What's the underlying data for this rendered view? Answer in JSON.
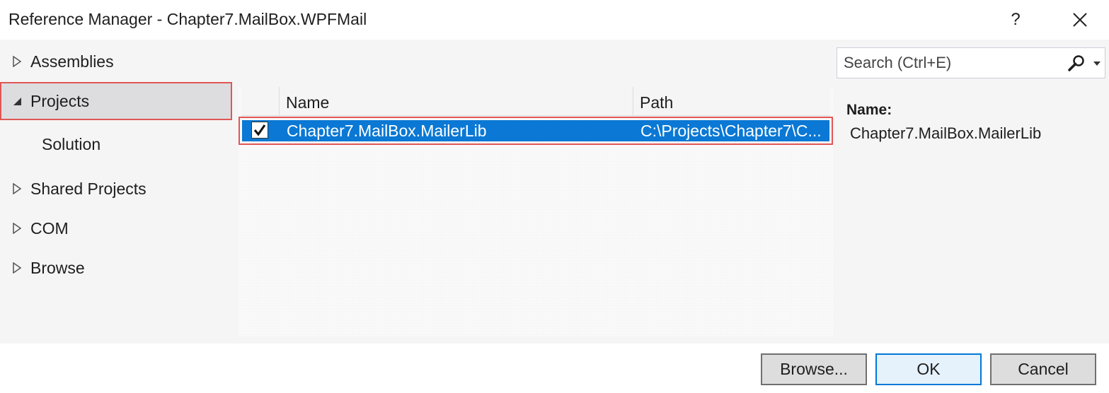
{
  "window": {
    "title": "Reference Manager - Chapter7.MailBox.WPFMail",
    "help_label": "?"
  },
  "nav": {
    "items": [
      {
        "label": "Assemblies",
        "expanded": false
      },
      {
        "label": "Projects",
        "expanded": true,
        "selected": true
      },
      {
        "label": "Solution",
        "child": true
      },
      {
        "label": "Shared Projects",
        "expanded": false
      },
      {
        "label": "COM",
        "expanded": false
      },
      {
        "label": "Browse",
        "expanded": false
      }
    ]
  },
  "list": {
    "columns": [
      "Name",
      "Path"
    ],
    "rows": [
      {
        "checked": true,
        "name": "Chapter7.MailBox.MailerLib",
        "path": "C:\\Projects\\Chapter7\\C..."
      }
    ]
  },
  "search": {
    "placeholder": "Search (Ctrl+E)"
  },
  "details": {
    "label": "Name:",
    "value": "Chapter7.MailBox.MailerLib"
  },
  "buttons": {
    "browse": "Browse...",
    "ok": "OK",
    "cancel": "Cancel"
  },
  "colors": {
    "selection": "#0a78d4",
    "highlight_border": "#e05656",
    "primary_border": "#0078d7"
  }
}
